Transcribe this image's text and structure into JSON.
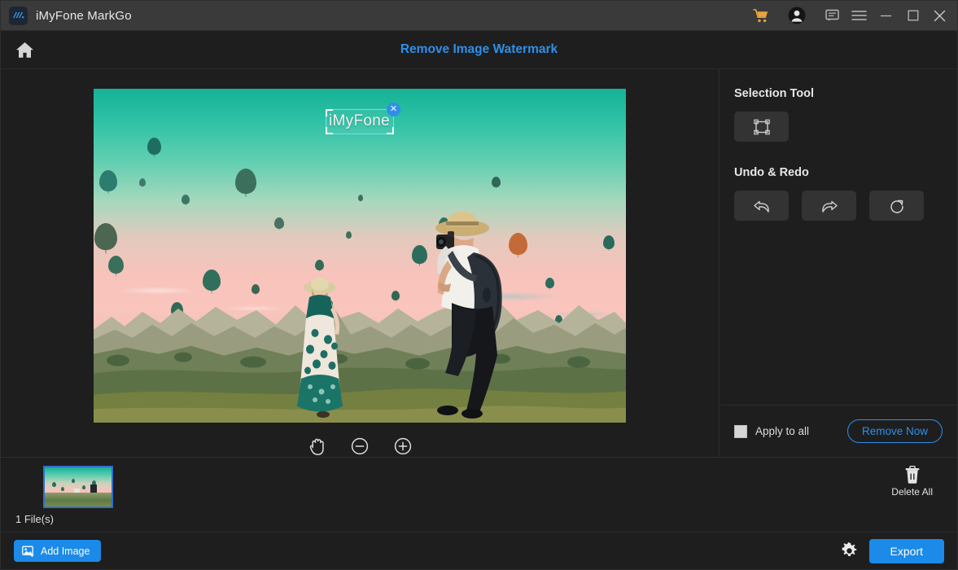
{
  "titlebar": {
    "app_title": "iMyFone MarkGo",
    "logo_icon": "markgo-logo-icon",
    "icons": [
      {
        "name": "cart-icon",
        "label": "Cart",
        "color": "#e8a33d"
      },
      {
        "name": "account-icon",
        "label": "Account"
      },
      {
        "name": "feedback-icon",
        "label": "Feedback"
      },
      {
        "name": "menu-icon",
        "label": "Menu"
      },
      {
        "name": "minimize-icon",
        "label": "Minimize"
      },
      {
        "name": "maximize-icon",
        "label": "Maximize"
      },
      {
        "name": "close-icon",
        "label": "Close"
      }
    ]
  },
  "header": {
    "home_icon": "home-icon",
    "page_title": "Remove Image Watermark",
    "title_color": "#2f8fe8"
  },
  "canvas": {
    "watermark": {
      "text": "iMyFone",
      "close_label": "✕"
    },
    "zoom_tools": [
      {
        "name": "pan-hand-tool",
        "label": "Pan"
      },
      {
        "name": "zoom-out-button",
        "label": "Zoom out"
      },
      {
        "name": "zoom-in-button",
        "label": "Zoom in"
      }
    ]
  },
  "right_panel": {
    "selection_tool_label": "Selection Tool",
    "selection_tool_button": "rectangle-select-icon",
    "undo_redo_label": "Undo & Redo",
    "undo_redo_buttons": [
      {
        "name": "undo-button",
        "icon": "undo-arrow-icon"
      },
      {
        "name": "redo-button",
        "icon": "redo-arrow-icon"
      },
      {
        "name": "reset-button",
        "icon": "refresh-icon"
      }
    ],
    "apply_to_all_label": "Apply to all",
    "apply_to_all_checked": true,
    "remove_now_label": "Remove Now",
    "accent_color": "#2f8fe8"
  },
  "filmstrip": {
    "file_count_label": "1 File(s)",
    "delete_all_label": "Delete All",
    "delete_all_icon": "trash-icon",
    "thumbnails": [
      {
        "name": "thumbnail-item",
        "selected": true
      }
    ]
  },
  "bottombar": {
    "add_image_label": "Add Image",
    "add_image_icon": "add-image-icon",
    "settings_icon": "gear-icon",
    "export_label": "Export",
    "button_color": "#1b8ae8"
  }
}
